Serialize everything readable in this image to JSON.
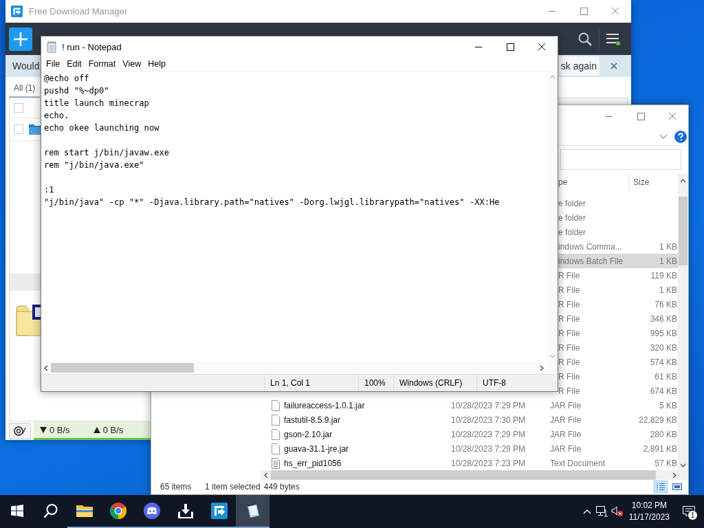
{
  "fdm": {
    "title": "Free Download Manager",
    "banner_text": "Would",
    "banner_button": "sk again",
    "filter_tab": {
      "label": "All (1)",
      "selected": true
    },
    "select_all": {
      "checked": false
    },
    "download_row": {
      "checked": false
    },
    "down_speed": "0 B/s",
    "up_speed": "0 B/s"
  },
  "explorer": {
    "columns": [
      "pe",
      "Size"
    ],
    "rows": [
      {
        "kind": "partial",
        "type": "e folder",
        "selected": false
      },
      {
        "kind": "partial",
        "type": "e folder",
        "selected": false
      },
      {
        "kind": "partial",
        "type": "e folder",
        "selected": false
      },
      {
        "kind": "partial",
        "type": "indows Comma...",
        "size": "1 KB",
        "selected": false
      },
      {
        "kind": "partial",
        "type": "indows Batch File",
        "size": "1 KB",
        "selected": true
      },
      {
        "kind": "partial",
        "type": "R File",
        "size": "119 KB",
        "selected": false
      },
      {
        "kind": "partial",
        "type": "R File",
        "size": "1 KB",
        "selected": false
      },
      {
        "kind": "partial",
        "type": "R File",
        "size": "76 KB",
        "selected": false
      },
      {
        "kind": "partial",
        "type": "R File",
        "size": "346 KB",
        "selected": false
      },
      {
        "kind": "partial",
        "type": "R File",
        "size": "995 KB",
        "selected": false
      },
      {
        "kind": "partial",
        "type": "R File",
        "size": "320 KB",
        "selected": false
      },
      {
        "kind": "partial",
        "type": "R File",
        "size": "574 KB",
        "selected": false
      },
      {
        "kind": "partial",
        "type": "R File",
        "size": "61 KB",
        "selected": false
      },
      {
        "kind": "partial",
        "type": "R File",
        "size": "674 KB",
        "selected": false
      },
      {
        "kind": "file",
        "name": "failureaccess-1.0.1.jar",
        "date": "10/28/2023 7:29 PM",
        "type": "JAR File",
        "size": "5 KB",
        "selected": false
      },
      {
        "kind": "file",
        "name": "fastutil-8.5.9.jar",
        "date": "10/28/2023 7:30 PM",
        "type": "JAR File",
        "size": "22,829 KB",
        "selected": false
      },
      {
        "kind": "file",
        "name": "gson-2.10.jar",
        "date": "10/28/2023 7:29 PM",
        "type": "JAR File",
        "size": "280 KB",
        "selected": false
      },
      {
        "kind": "file",
        "name": "guava-31.1-jre.jar",
        "date": "10/28/2023 7:29 PM",
        "type": "JAR File",
        "size": "2,891 KB",
        "selected": false
      },
      {
        "kind": "document",
        "name": "hs_err_pid1056",
        "date": "10/28/2023 7:23 PM",
        "type": "Text Document",
        "size": "57 KB",
        "selected": false
      }
    ],
    "status": {
      "count": "65 items",
      "selection": "1 item selected",
      "size": "449 bytes"
    }
  },
  "notepad": {
    "title": "! run - Notepad",
    "menu": [
      "File",
      "Edit",
      "Format",
      "View",
      "Help"
    ],
    "content": "@echo off\npushd \"%~dp0\"\ntitle launch minecrap\necho.\necho okee launching now\n\nrem start j/bin/javaw.exe\nrem \"j/bin/java.exe\"\n\n:1\n\"j/bin/java\" -cp \"*\" -Djava.library.path=\"natives\" -Dorg.lwjgl.librarypath=\"natives\" -XX:He",
    "status": [
      "Ln 1, Col 1",
      "100%",
      "Windows (CRLF)",
      "UTF-8"
    ]
  },
  "taskbar": {
    "apps": [
      {
        "kind": "explorer",
        "active": false
      },
      {
        "kind": "chrome",
        "active": false
      },
      {
        "kind": "discord",
        "active": false
      },
      {
        "kind": "download",
        "active": false
      },
      {
        "kind": "fdm",
        "active": false
      },
      {
        "kind": "notepad",
        "active": true
      }
    ],
    "time": "10:02 PM",
    "date": "11/17/2023",
    "notifications": "1"
  }
}
